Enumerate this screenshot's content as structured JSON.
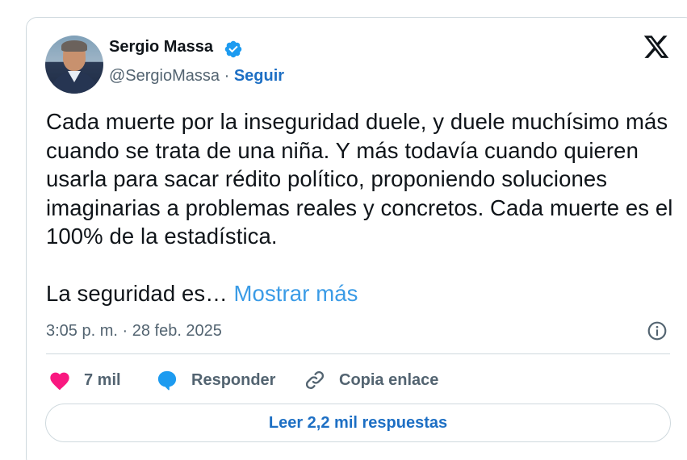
{
  "author": {
    "name": "Sergio Massa",
    "handle": "@SergioMassa",
    "separator": " · ",
    "follow_label": "Seguir",
    "verified_color": "#1d9bf0"
  },
  "tweet": {
    "paragraph1": "Cada muerte por la inseguridad duele, y duele muchísimo más cuando se trata de una niña. Y más todavía cuando quieren usarla para sacar rédito político, proponiendo soluciones imaginarias a problemas reales y concretos. Cada muerte es el 100% de la estadística.",
    "paragraph2": "La seguridad es… ",
    "show_more": "Mostrar más",
    "timestamp": "3:05 p. m. · 28 feb. 2025"
  },
  "actions": {
    "likes": "7 mil",
    "reply": "Responder",
    "copy_link": "Copia enlace"
  },
  "replies_button": "Leer 2,2 mil respuestas",
  "icons": {
    "brand": "x-logo-icon",
    "verified": "verified-badge-icon",
    "info": "info-icon",
    "like": "heart-icon",
    "reply": "speech-bubble-icon",
    "copy": "link-icon"
  },
  "colors": {
    "heart": "#f91880",
    "reply": "#1d9bf0",
    "link_blue": "#1d6fc4",
    "show_more": "#3a9be6"
  }
}
